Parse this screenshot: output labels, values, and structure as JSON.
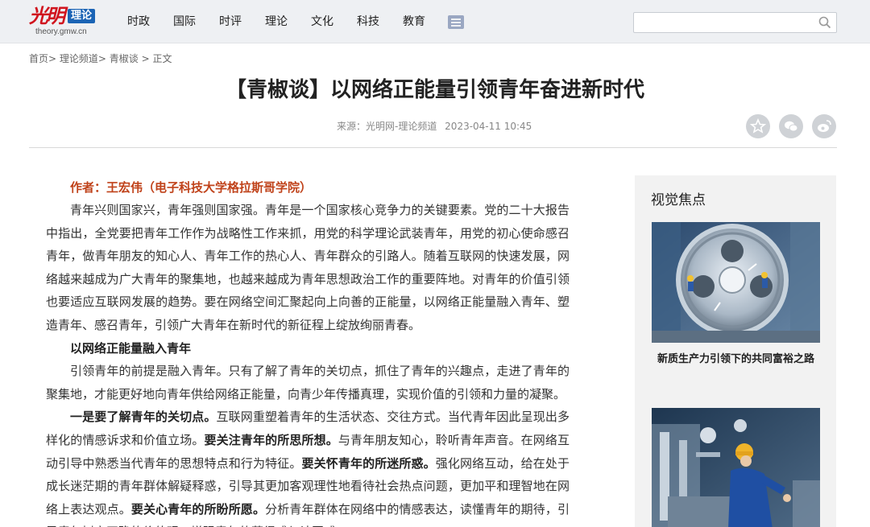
{
  "header": {
    "logo_text": "光明",
    "logo_badge": "理论",
    "logo_url": "theory.gmw.cn",
    "nav": [
      "时政",
      "国际",
      "时评",
      "理论",
      "文化",
      "科技",
      "教育"
    ],
    "search": {
      "value": "",
      "placeholder": ""
    }
  },
  "breadcrumb": {
    "items": [
      "首页",
      "理论频道",
      "青椒谈",
      "正文"
    ]
  },
  "article": {
    "title": "【青椒谈】以网络正能量引领青年奋进新时代",
    "source": "来源：光明网-理论频道",
    "date": "2023-04-11 10:45",
    "author": "作者：王宏伟（电子科技大学格拉斯哥学院）",
    "p1": "青年兴则国家兴，青年强则国家强。青年是一个国家核心竞争力的关键要素。党的二十大报告中指出，全党要把青年工作作为战略性工作来抓，用党的科学理论武装青年，用党的初心使命感召青年，做青年朋友的知心人、青年工作的热心人、青年群众的引路人。随着互联网的快速发展，网络越来越成为广大青年的聚集地，也越来越成为青年思想政治工作的重要阵地。对青年的价值引领也要适应互联网发展的趋势。要在网络空间汇聚起向上向善的正能量，以网络正能量融入青年、塑造青年、感召青年，引领广大青年在新时代的新征程上绽放绚丽青春。",
    "subhead": "以网络正能量融入青年",
    "p2": "引领青年的前提是融入青年。只有了解了青年的关切点，抓住了青年的兴趣点，走进了青年的聚集地，才能更好地向青年供给网络正能量，向青少年传播真理，实现价值的引领和力量的凝聚。",
    "p3": {
      "b1": "一是要了解青年的关切点。",
      "t1": "互联网重塑着青年的生活状态、交往方式。当代青年因此呈现出多样化的情感诉求和价值立场。",
      "b2": "要关注青年的所思所想。",
      "t2": "与青年朋友知心，聆听青年声音。在网络互动引导中熟悉当代青年的思想特点和行为特征。",
      "b3": "要关怀青年的所迷所惑。",
      "t3": "强化网络互动，给在处于成长迷茫期的青年群体解疑释惑，引导其更加客观理性地看待社会热点问题，更加平和理智地在网络上表达观点。",
      "b4": "要关心青年的所盼所愿。",
      "t4": "分析青年群体在网络中的情感表达，读懂青年的期待，引导青年树立正确的价值观，增强青年的获得感与认同感。"
    }
  },
  "sidebar": {
    "title": "视觉焦点",
    "cards": [
      {
        "caption": "新质生产力引领下的共同富裕之路"
      }
    ]
  },
  "colors": {
    "accent_red": "#d0141e",
    "author_orange": "#c0431b",
    "badge_blue": "#1b64b5"
  }
}
